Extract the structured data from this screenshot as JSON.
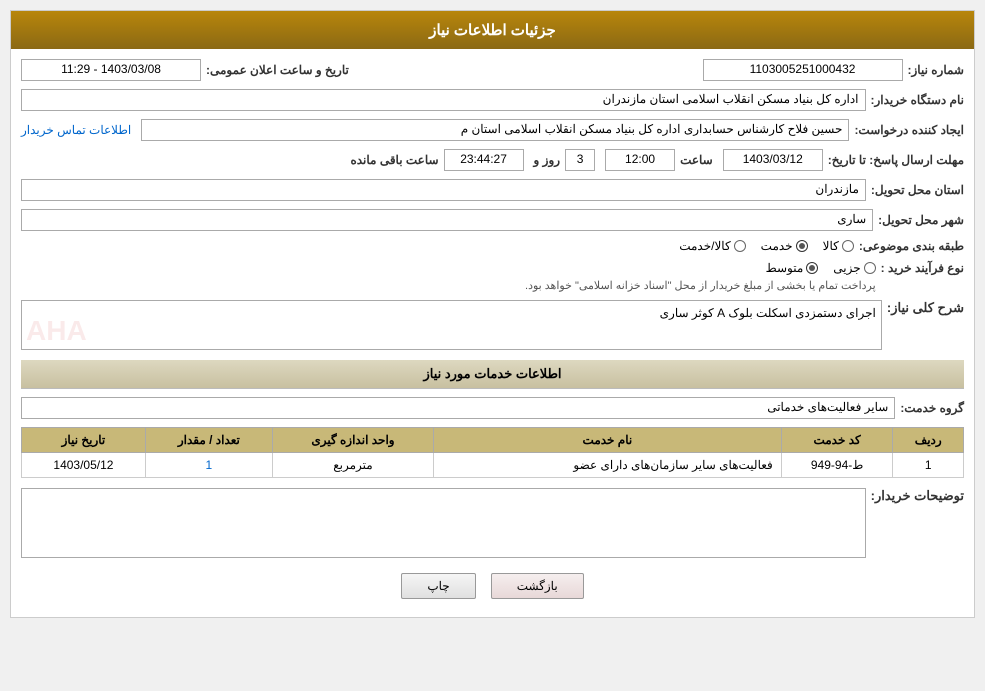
{
  "header": {
    "title": "جزئیات اطلاعات نیاز"
  },
  "fields": {
    "shomara_niaz_label": "شماره نیاز:",
    "shomara_niaz_value": "1103005251000432",
    "nam_dastgah_label": "نام دستگاه خریدار:",
    "nam_dastgah_value": "اداره کل بنیاد مسکن انقلاب اسلامی استان مازندران",
    "ijad_konande_label": "ایجاد کننده درخواست:",
    "ijad_konande_value": "حسین فلاح کارشناس حسابداری اداره کل بنیاد مسکن انقلاب اسلامی استان م",
    "tammas_label": "اطلاعات تماس خریدار",
    "mohlat_label": "مهلت ارسال پاسخ: تا تاریخ:",
    "date_value": "1403/03/12",
    "saat_label": "ساعت",
    "saat_value": "12:00",
    "rooz_label": "روز و",
    "rooz_value": "3",
    "baqi_mande_label": "ساعت باقی مانده",
    "baqi_mande_value": "23:44:27",
    "ostan_label": "استان محل تحویل:",
    "ostan_value": "مازندران",
    "shahr_label": "شهر محل تحویل:",
    "shahr_value": "ساری",
    "tabaqe_label": "طبقه بندی موضوعی:",
    "radio_kala": "کالا",
    "radio_khedmat": "خدمت",
    "radio_kala_khedmat": "کالا/خدمت",
    "selected_radio": "khedmat",
    "noe_farayand_label": "نوع فرآیند خرید :",
    "radio_jezee": "جزیی",
    "radio_mottavasset": "متوسط",
    "farayand_note": "پرداخت تمام یا بخشی از مبلغ خریدار از محل \"اسناد خزانه اسلامی\" خواهد بود.",
    "selected_farayand": "mottavasset",
    "sharh_label": "شرح کلی نیاز:",
    "sharh_value": "اجرای دستمزدی اسکلت بلوک A کوثر ساری",
    "khadamat_section_title": "اطلاعات خدمات مورد نیاز",
    "goroh_khedmat_label": "گروه خدمت:",
    "goroh_khedmat_value": "سایر فعالیت‌های خدماتی",
    "table": {
      "headers": [
        "ردیف",
        "کد خدمت",
        "نام خدمت",
        "واحد اندازه گیری",
        "تعداد / مقدار",
        "تاریخ نیاز"
      ],
      "rows": [
        {
          "radif": "1",
          "code": "ط-94-949",
          "name": "فعالیت‌های سایر سازمان‌های دارای عضو",
          "unit": "مترمربع",
          "count": "1",
          "date": "1403/05/12"
        }
      ]
    },
    "tozihat_label": "توضیحات خریدار:",
    "tozihat_value": "",
    "tarikhe_elan_label": "تاریخ و ساعت اعلان عمومی:",
    "tarikhe_elan_value": "1403/03/08 - 11:29"
  },
  "buttons": {
    "print": "چاپ",
    "back": "بازگشت"
  }
}
